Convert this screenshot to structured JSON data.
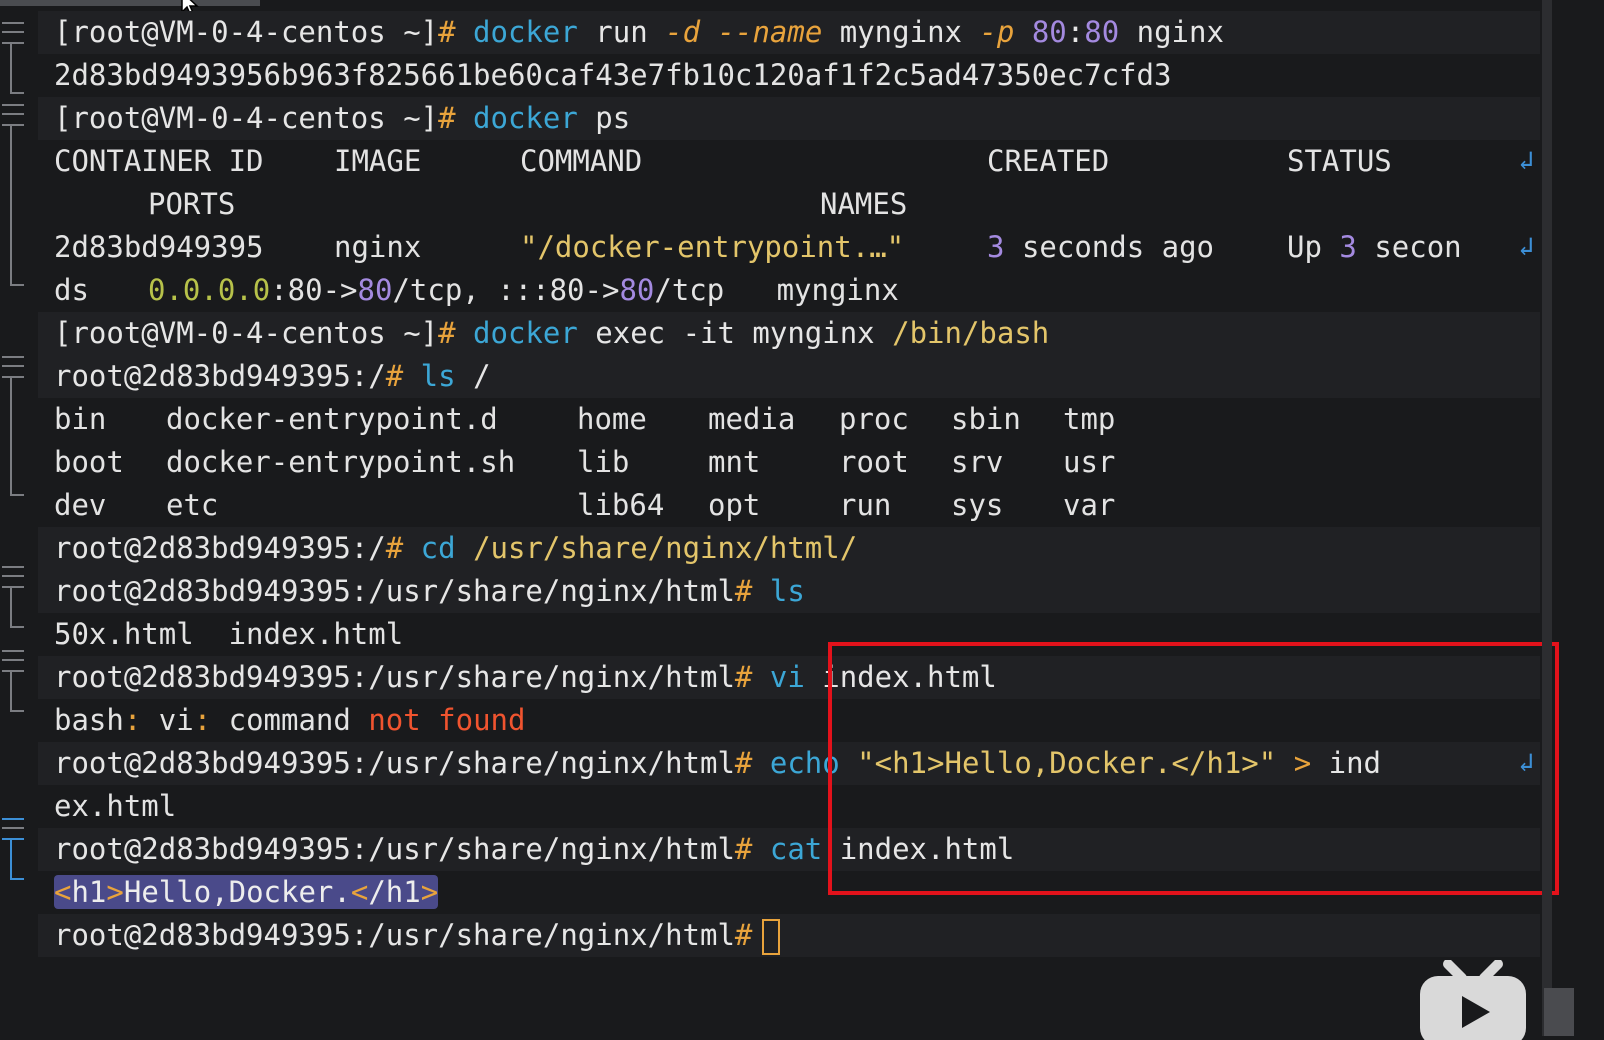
{
  "terminal": {
    "line1": {
      "prompt": "[root@VM-0-4-centos ~]",
      "hash": "#",
      "cmd": "docker",
      "t1": "run",
      "opt1": "-d",
      "opt2": "--name",
      "t2": "mynginx",
      "opt3": "-p",
      "port_a": "80",
      "colon": ":",
      "port_b": "80",
      "t3": "nginx"
    },
    "line2": {
      "text": "2d83bd9493956b963f825661be60caf43e7fb10c120af1f2c5ad47350ec7cfd3"
    },
    "line3": {
      "prompt": "[root@VM-0-4-centos ~]",
      "hash": "#",
      "cmd": "docker",
      "t1": "ps"
    },
    "ps_header": {
      "container_id": "CONTAINER ID",
      "image": "IMAGE",
      "command": "COMMAND",
      "created": "CREATED",
      "status": "STATUS",
      "ports": "PORTS",
      "names": "NAMES"
    },
    "ps_row": {
      "container_id": "2d83bd949395",
      "image": "nginx",
      "command": "\"/docker-entrypoint.…\"",
      "created_num": "3",
      "created_rest": "seconds ago",
      "status_up": "Up",
      "status_num": "3",
      "status_rest": "secon",
      "status_wrap": "ds",
      "ports_ip": "0.0.0.0",
      "ports_p1": ":80->",
      "ports_p2": "80",
      "ports_p3": "/tcp, ",
      "ports_p4": ":::80->",
      "ports_p5": "80",
      "ports_p6": "/tcp",
      "names": "mynginx"
    },
    "line_exec": {
      "prompt": "[root@VM-0-4-centos ~]",
      "hash": "#",
      "cmd": "docker",
      "t1": "exec -it mynginx",
      "t2": "/bin/bash"
    },
    "line_ls": {
      "prompt": "root@2d83bd949395:/",
      "hash": "#",
      "cmd": "ls",
      "arg": "/"
    },
    "ls_rows": [
      [
        "bin",
        "docker-entrypoint.d",
        "home",
        "media",
        "proc",
        "sbin",
        "tmp"
      ],
      [
        "boot",
        "docker-entrypoint.sh",
        "lib",
        "mnt",
        "root",
        "srv",
        "usr"
      ],
      [
        "dev",
        "etc",
        "lib64",
        "opt",
        "run",
        "sys",
        "var"
      ]
    ],
    "line_cd": {
      "prompt": "root@2d83bd949395:/",
      "hash": "#",
      "cmd": "cd",
      "arg": "/usr/share/nginx/html/"
    },
    "line_ls2": {
      "prompt": "root@2d83bd949395:/usr/share/nginx/html",
      "hash": "#",
      "cmd": "ls"
    },
    "ls2_out": "50x.html  index.html",
    "line_vi": {
      "prompt": "root@2d83bd949395:/usr/share/nginx/html",
      "hash": "#",
      "cmd": "vi",
      "arg": "index.html"
    },
    "vi_err": {
      "p1": "bash",
      "c1": ":",
      "p2": " vi",
      "c2": ":",
      "p3": " command ",
      "red": "not found"
    },
    "line_echo": {
      "prompt": "root@2d83bd949395:/usr/share/nginx/html",
      "hash": "#",
      "cmd": "echo",
      "q1": "\"",
      "str": "<h1>Hello,Docker.</h1>",
      "q2": "\"",
      "redir": ">",
      "arg": "ind",
      "wrap": "ex.html"
    },
    "line_cat": {
      "prompt": "root@2d83bd949395:/usr/share/nginx/html",
      "hash": "#",
      "cmd": "cat",
      "arg": "index.html"
    },
    "cat_out": {
      "open_lt": "<",
      "open": "h1",
      "open_gt": ">",
      "text": "Hello,Docker.",
      "close_lt": "<",
      "close": "/h1",
      "close_gt": ">"
    },
    "line_last": {
      "prompt": "root@2d83bd949395:/usr/share/nginx/html",
      "hash": "#"
    }
  },
  "icons": {
    "wrap": "↲",
    "logo": "bilibili-logo-icon",
    "mouse": "mouse-pointer-icon"
  },
  "colors": {
    "background": "#191a1c",
    "command_blue": "#3ca7d6",
    "option_orange": "#e8a33c",
    "number_purple": "#a48ae0",
    "ip_green": "#b7c24a",
    "error_red": "#f0542f",
    "annotation_box": "#e3121b"
  }
}
